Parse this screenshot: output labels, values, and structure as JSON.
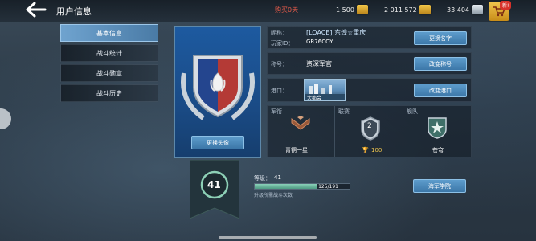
{
  "header": {
    "title": "用户信息",
    "buy_text": "购买0天",
    "resources": [
      {
        "name": "gold",
        "value": "1 500"
      },
      {
        "name": "credits",
        "value": "2 011 572"
      },
      {
        "name": "silver",
        "value": "33 404"
      }
    ],
    "shop_badge": "新!"
  },
  "menu": {
    "items": [
      {
        "label": "基本信息",
        "active": true
      },
      {
        "label": "战斗统计",
        "active": false
      },
      {
        "label": "战斗勋章",
        "active": false
      },
      {
        "label": "战斗历史",
        "active": false
      }
    ]
  },
  "avatar": {
    "change_label": "更换头像"
  },
  "profile": {
    "nickname_label": "昵称：",
    "nickname_value": "[LOACE] 东煌☆重庆",
    "player_id_label": "玩家ID：",
    "player_id_value": "GR76COY",
    "change_name_label": "更换名字",
    "title_label": "称号：",
    "title_value": "资深军官",
    "change_title_label": "改变称号",
    "port_label": "港口：",
    "port_name": "大都会",
    "change_port_label": "改变港口"
  },
  "stats": {
    "rank_label": "军衔",
    "rank_value": "青铜一星",
    "league_label": "联赛",
    "league_badge": "2",
    "league_value": "100",
    "fleet_label": "舰队",
    "fleet_value": "苍穹"
  },
  "level": {
    "badge": "41",
    "label": "等级：",
    "value": "41",
    "progress_text": "125/191",
    "progress_fraction": 0.654,
    "note": "升级所需战斗次数",
    "academy_label": "海军学院"
  },
  "colors": {
    "accent": "#4a7ba6",
    "gold": "#f0c54d",
    "alert": "#e45a4a"
  }
}
